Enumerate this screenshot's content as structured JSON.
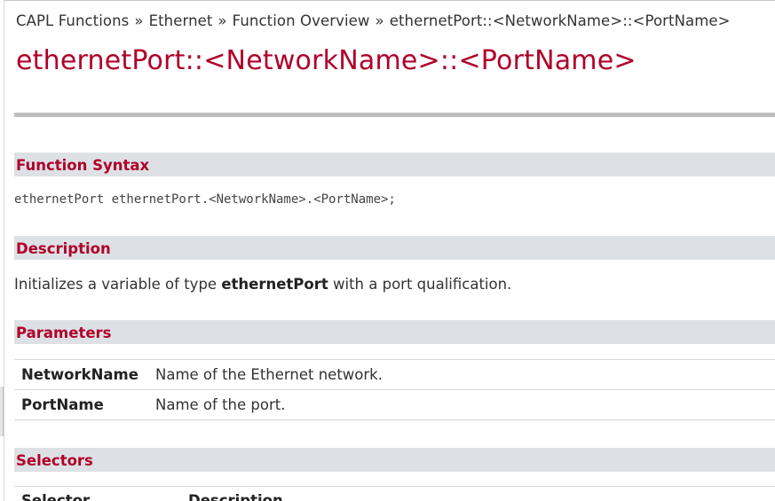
{
  "breadcrumb": {
    "items": [
      "CAPL Functions",
      "Ethernet",
      "Function Overview",
      "ethernetPort::<NetworkName>::<PortName>"
    ],
    "separator": "»"
  },
  "page_title": "ethernetPort::<NetworkName>::<PortName>",
  "sections": {
    "syntax_title": "Function Syntax",
    "syntax_code": "ethernetPort ethernetPort.<NetworkName>.<PortName>;",
    "description_title": "Description",
    "description_prefix": "Initializes a variable of type ",
    "description_bold": "ethernetPort",
    "description_suffix": " with a port qualification.",
    "parameters_title": "Parameters",
    "parameters": [
      {
        "name": "NetworkName",
        "description": "Name of the Ethernet network."
      },
      {
        "name": "PortName",
        "description": "Name of the port."
      }
    ],
    "selectors_title": "Selectors",
    "selectors_columns": [
      "Selector",
      "Description"
    ]
  },
  "colors": {
    "accent": "#b0002a",
    "section_bg": "#dde1e5",
    "rule": "#bfbfbf"
  }
}
